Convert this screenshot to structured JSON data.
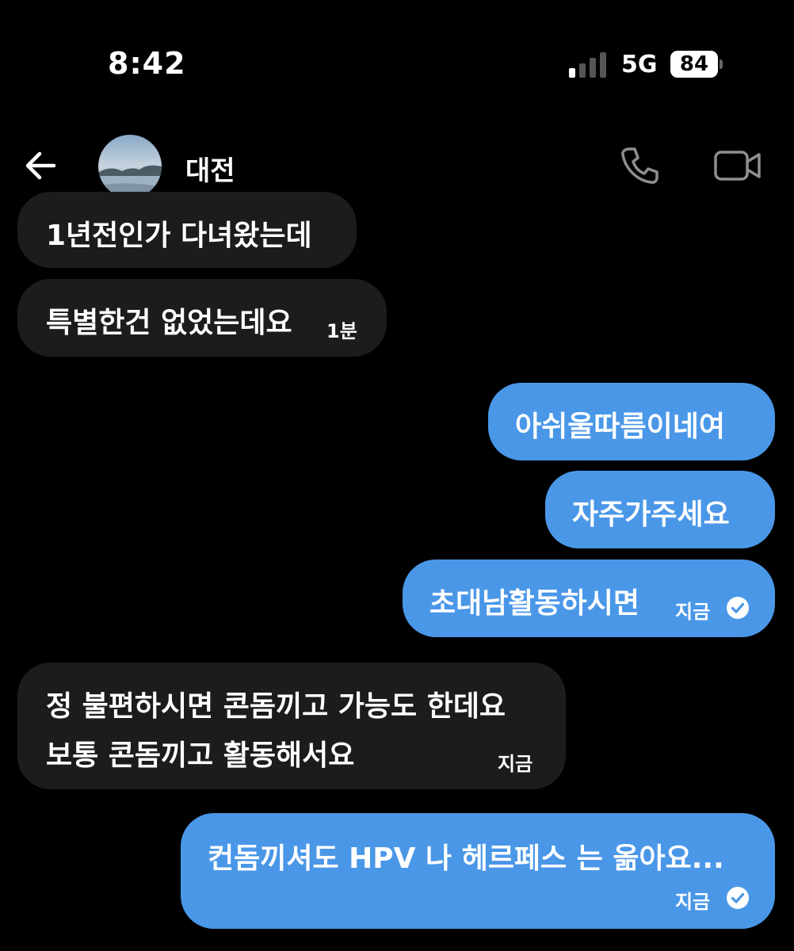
{
  "status_bar": {
    "time": "8:42",
    "network": "5G",
    "battery": "84"
  },
  "header": {
    "contact_name": "대전"
  },
  "messages": [
    {
      "side": "received",
      "text": "1년전인가 다녀왔는데",
      "time": ""
    },
    {
      "side": "received",
      "text": "특별한건 없었는데요",
      "time": "1분"
    },
    {
      "side": "sent",
      "text": "아쉬울따름이네여",
      "time": ""
    },
    {
      "side": "sent",
      "text": "자주가주세요",
      "time": ""
    },
    {
      "side": "sent",
      "text": "초대남활동하시면",
      "time": "지금",
      "read": true
    },
    {
      "side": "received",
      "lines": [
        "정 불편하시면 콘돔끼고 가능도 한데요",
        "보통 콘돔끼고 활동해서요"
      ],
      "time": "지금"
    },
    {
      "side": "sent",
      "text": "컨돔끼셔도 HPV 나 헤르페스 는 옮아요...",
      "time": "지금",
      "read": true
    }
  ]
}
